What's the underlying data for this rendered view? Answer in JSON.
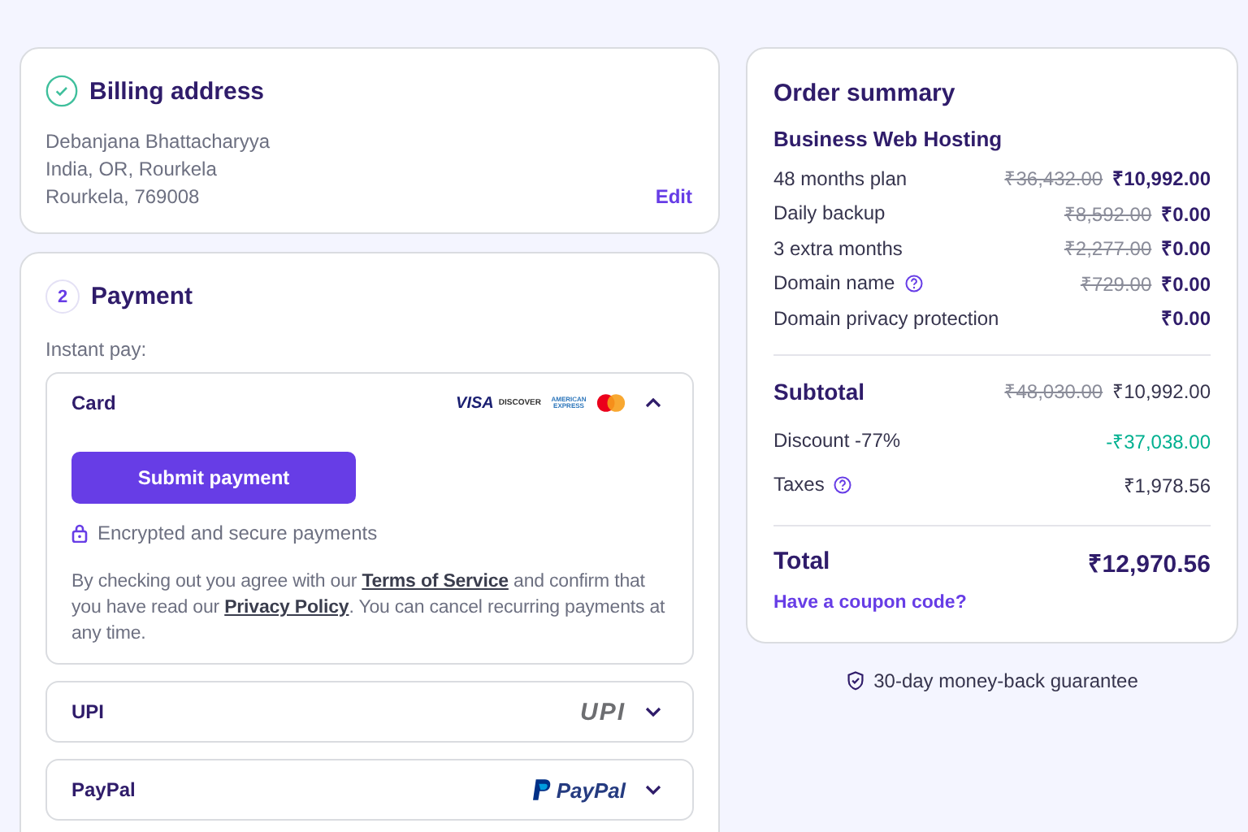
{
  "billing": {
    "step_done": true,
    "title": "Billing address",
    "lines": [
      "Debanjana Bhattacharyya",
      "India, OR, Rourkela",
      "Rourkela, 769008"
    ],
    "edit_link": "Edit"
  },
  "payment": {
    "step": "2",
    "title": "Payment",
    "instant_label": "Instant pay:",
    "methods": [
      {
        "kind": "card",
        "name": "Card",
        "expanded": true,
        "logos": [
          "VISA",
          "DISCOVER",
          "AMERICAN EXPRESS"
        ]
      },
      {
        "kind": "upi",
        "name": "UPI",
        "expanded": false,
        "logos": [
          "UPI"
        ]
      },
      {
        "kind": "paypal",
        "name": "PayPal",
        "expanded": false,
        "logos": [
          "PayPal"
        ]
      }
    ],
    "submit_button": "Submit payment",
    "secure_note": "Encrypted and secure payments",
    "legal": [
      {
        "kind": "text",
        "text": "By checking out you agree with our "
      },
      {
        "kind": "link",
        "text": "Terms of Service"
      },
      {
        "kind": "text",
        "text": " and confirm that you have read our "
      },
      {
        "kind": "link",
        "text": "Privacy Policy"
      },
      {
        "kind": "text",
        "text": ". You can cancel recurring payments at any time."
      }
    ]
  },
  "summary": {
    "title": "Order summary",
    "product": "Business Web Hosting",
    "items": [
      {
        "label": "48 months plan",
        "help": false,
        "old_price": "₹36,432.00",
        "price": "₹10,992.00"
      },
      {
        "label": "Daily backup",
        "help": false,
        "old_price": "₹8,592.00",
        "price": "₹0.00"
      },
      {
        "label": "3 extra months",
        "help": false,
        "old_price": "₹2,277.00",
        "price": "₹0.00"
      },
      {
        "label": "Domain name",
        "help": true,
        "old_price": "₹729.00",
        "price": "₹0.00"
      },
      {
        "label": "Domain privacy protection",
        "help": false,
        "price": "₹0.00"
      }
    ],
    "subtotal": {
      "label": "Subtotal",
      "old_price": "₹48,030.00",
      "price": "₹10,992.00"
    },
    "adjustments": [
      {
        "kind": "discount",
        "label": "Discount -77%",
        "help": false,
        "price": "-₹37,038.00"
      },
      {
        "kind": "tax",
        "label": "Taxes",
        "help": true,
        "price": "₹1,978.56"
      }
    ],
    "total": {
      "label": "Total",
      "price": "₹12,970.56"
    },
    "coupon_link": "Have a coupon code?"
  },
  "guarantee": "30-day money-back guarantee"
}
